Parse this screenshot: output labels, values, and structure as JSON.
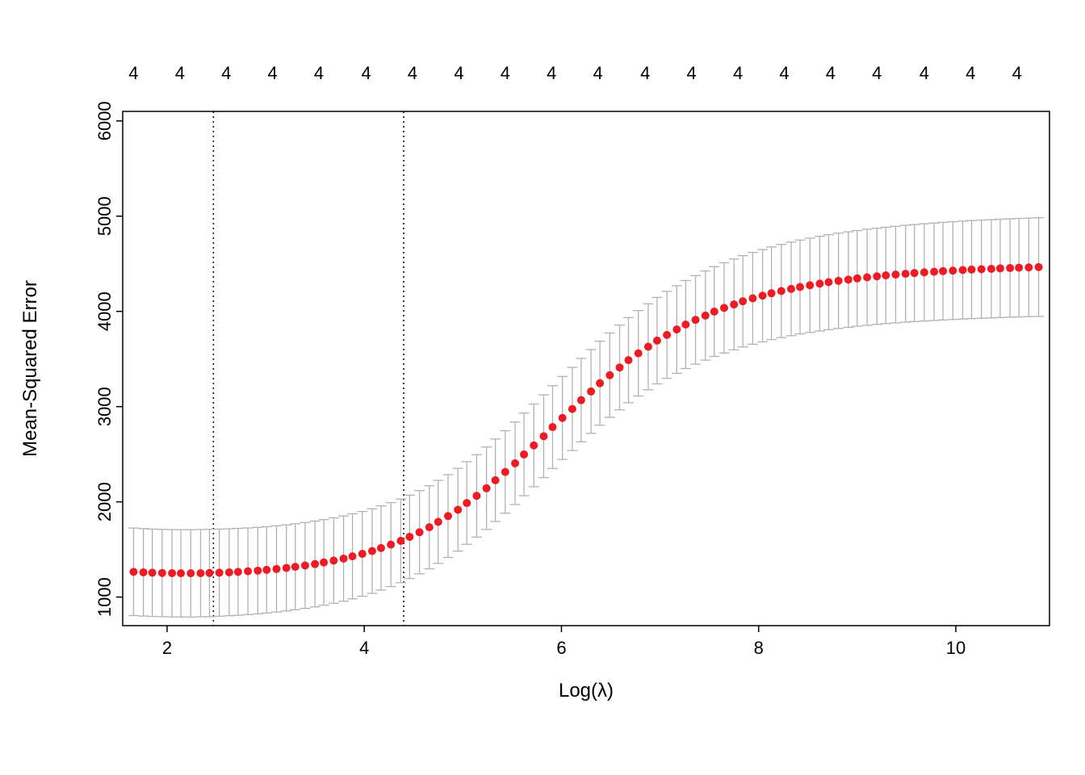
{
  "chart_data": {
    "type": "scatter",
    "title": "",
    "xlabel": "Log(λ)",
    "ylabel": "Mean-Squared Error",
    "xlim": [
      1.55,
      10.95
    ],
    "ylim": [
      700,
      6100
    ],
    "x_ticks": [
      2,
      4,
      6,
      8,
      10
    ],
    "y_ticks": [
      1000,
      2000,
      3000,
      4000,
      5000,
      6000
    ],
    "top_labels": [
      "4",
      "4",
      "4",
      "4",
      "4",
      "4",
      "4",
      "4",
      "4",
      "4",
      "4",
      "4",
      "4",
      "4",
      "4",
      "4",
      "4",
      "4",
      "4",
      "4"
    ],
    "top_label_x": [
      1.66,
      2.13,
      2.6,
      3.07,
      3.54,
      4.02,
      4.49,
      4.96,
      5.43,
      5.9,
      6.37,
      6.85,
      7.32,
      7.79,
      8.26,
      8.73,
      9.2,
      9.68,
      10.15,
      10.62
    ],
    "vlines": [
      2.47,
      4.4
    ],
    "point_color": "#ed1c24",
    "errorbar_color": "#b2b2b2",
    "x": [
      1.66,
      1.76,
      1.85,
      1.95,
      2.05,
      2.14,
      2.24,
      2.34,
      2.43,
      2.53,
      2.63,
      2.72,
      2.82,
      2.92,
      3.01,
      3.11,
      3.21,
      3.3,
      3.4,
      3.5,
      3.59,
      3.69,
      3.79,
      3.88,
      3.98,
      4.08,
      4.17,
      4.27,
      4.37,
      4.46,
      4.56,
      4.66,
      4.75,
      4.85,
      4.95,
      5.04,
      5.14,
      5.24,
      5.33,
      5.43,
      5.53,
      5.62,
      5.72,
      5.82,
      5.91,
      6.01,
      6.11,
      6.2,
      6.3,
      6.39,
      6.49,
      6.59,
      6.68,
      6.78,
      6.88,
      6.97,
      7.07,
      7.17,
      7.26,
      7.36,
      7.46,
      7.55,
      7.65,
      7.75,
      7.84,
      7.94,
      8.04,
      8.13,
      8.23,
      8.33,
      8.42,
      8.52,
      8.62,
      8.71,
      8.81,
      8.91,
      9.0,
      9.1,
      9.2,
      9.29,
      9.39,
      9.49,
      9.58,
      9.68,
      9.78,
      9.87,
      9.97,
      10.07,
      10.16,
      10.26,
      10.36,
      10.45,
      10.55,
      10.64,
      10.74,
      10.84
    ],
    "y": [
      1265,
      1260,
      1256,
      1253,
      1251,
      1250,
      1250,
      1251,
      1253,
      1256,
      1260,
      1265,
      1271,
      1278,
      1286,
      1295,
      1306,
      1318,
      1332,
      1347,
      1364,
      1383,
      1404,
      1428,
      1454,
      1483,
      1515,
      1551,
      1590,
      1633,
      1681,
      1733,
      1790,
      1851,
      1917,
      1988,
      2063,
      2143,
      2227,
      2314,
      2405,
      2498,
      2593,
      2689,
      2785,
      2881,
      2975,
      3068,
      3159,
      3246,
      3330,
      3411,
      3488,
      3560,
      3629,
      3693,
      3753,
      3810,
      3862,
      3911,
      3956,
      3998,
      4037,
      4073,
      4106,
      4137,
      4165,
      4190,
      4214,
      4236,
      4256,
      4274,
      4291,
      4307,
      4321,
      4334,
      4347,
      4358,
      4368,
      4378,
      4387,
      4395,
      4403,
      4410,
      4416,
      4423,
      4428,
      4434,
      4439,
      4443,
      4447,
      4452,
      4455,
      4459,
      4462,
      4465
    ],
    "ylo": [
      806,
      801,
      797,
      794,
      792,
      791,
      791,
      793,
      795,
      799,
      804,
      809,
      816,
      824,
      833,
      843,
      854,
      867,
      881,
      897,
      915,
      935,
      957,
      981,
      1009,
      1039,
      1073,
      1110,
      1151,
      1195,
      1244,
      1297,
      1354,
      1416,
      1483,
      1554,
      1630,
      1710,
      1794,
      1881,
      1972,
      2065,
      2159,
      2255,
      2350,
      2445,
      2539,
      2630,
      2719,
      2805,
      2888,
      2966,
      3041,
      3111,
      3177,
      3239,
      3297,
      3350,
      3400,
      3446,
      3488,
      3527,
      3563,
      3596,
      3627,
      3655,
      3680,
      3704,
      3725,
      3745,
      3763,
      3779,
      3794,
      3808,
      3821,
      3833,
      3844,
      3854,
      3863,
      3872,
      3879,
      3887,
      3893,
      3899,
      3905,
      3910,
      3915,
      3920,
      3924,
      3928,
      3932,
      3935,
      3939,
      3942,
      3945,
      3947
    ],
    "yhi": [
      1725,
      1719,
      1714,
      1711,
      1709,
      1708,
      1708,
      1710,
      1712,
      1714,
      1717,
      1721,
      1726,
      1732,
      1739,
      1748,
      1758,
      1770,
      1783,
      1798,
      1814,
      1832,
      1852,
      1875,
      1899,
      1927,
      1958,
      1992,
      2030,
      2071,
      2118,
      2169,
      2225,
      2286,
      2352,
      2422,
      2496,
      2576,
      2660,
      2747,
      2838,
      2932,
      3027,
      3124,
      3220,
      3316,
      3412,
      3506,
      3599,
      3687,
      3773,
      3856,
      3935,
      4009,
      4080,
      4147,
      4210,
      4269,
      4324,
      4376,
      4424,
      4470,
      4511,
      4550,
      4586,
      4619,
      4649,
      4677,
      4703,
      4727,
      4749,
      4769,
      4788,
      4805,
      4821,
      4836,
      4849,
      4862,
      4873,
      4884,
      4894,
      4904,
      4912,
      4920,
      4928,
      4935,
      4942,
      4948,
      4954,
      4959,
      4963,
      4968,
      4972,
      4976,
      4980,
      4983
    ]
  }
}
